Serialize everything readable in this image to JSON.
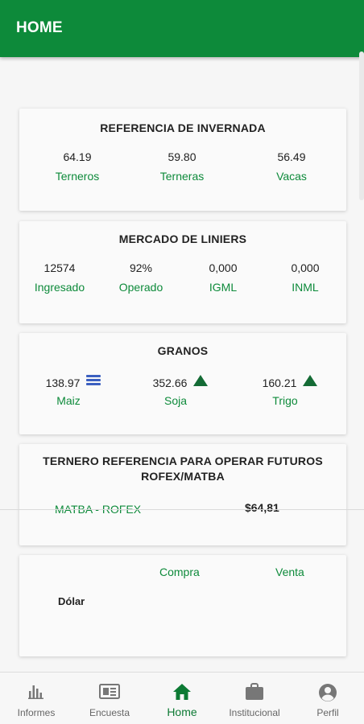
{
  "header": {
    "title": "HOME"
  },
  "invernada": {
    "title": "REFERENCIA DE INVERNADA",
    "items": [
      {
        "value": "64.19",
        "label": "Terneros"
      },
      {
        "value": "59.80",
        "label": "Terneras"
      },
      {
        "value": "56.49",
        "label": "Vacas"
      }
    ]
  },
  "liniers": {
    "title": "MERCADO DE LINIERS",
    "items": [
      {
        "value": "12574",
        "label": "Ingresado"
      },
      {
        "value": "92%",
        "label": "Operado"
      },
      {
        "value": "0,000",
        "label": "IGML"
      },
      {
        "value": "0,000",
        "label": "INML"
      }
    ]
  },
  "granos": {
    "title": "GRANOS",
    "items": [
      {
        "value": "138.97",
        "label": "Maiz",
        "trend_icon": "equal-icon"
      },
      {
        "value": "352.66",
        "label": "Soja",
        "trend_icon": "arrow-up-icon"
      },
      {
        "value": "160.21",
        "label": "Trigo",
        "trend_icon": "arrow-up-icon"
      }
    ],
    "colors": {
      "equal": "#3b5fc0",
      "up": "#146b35"
    }
  },
  "futuros": {
    "title_line1": "TERNERO REFERENCIA PARA OPERAR FUTUROS",
    "title_line2": "ROFEX/MATBA",
    "market_label": "MATBA - ROFEX",
    "price": "$64,81"
  },
  "dolar": {
    "buy_header": "Compra",
    "sell_header": "Venta",
    "row_label": "Dólar"
  },
  "bottom_nav": {
    "items": [
      {
        "label": "Informes",
        "icon": "bar-chart-icon"
      },
      {
        "label": "Encuesta",
        "icon": "newspaper-icon"
      },
      {
        "label": "Home",
        "icon": "home-icon",
        "active": true
      },
      {
        "label": "Institucional",
        "icon": "briefcase-icon"
      },
      {
        "label": "Perfil",
        "icon": "account-circle-icon"
      }
    ]
  },
  "colors": {
    "primary": "#0d8a3a",
    "accent_text": "#0d8a3a"
  }
}
